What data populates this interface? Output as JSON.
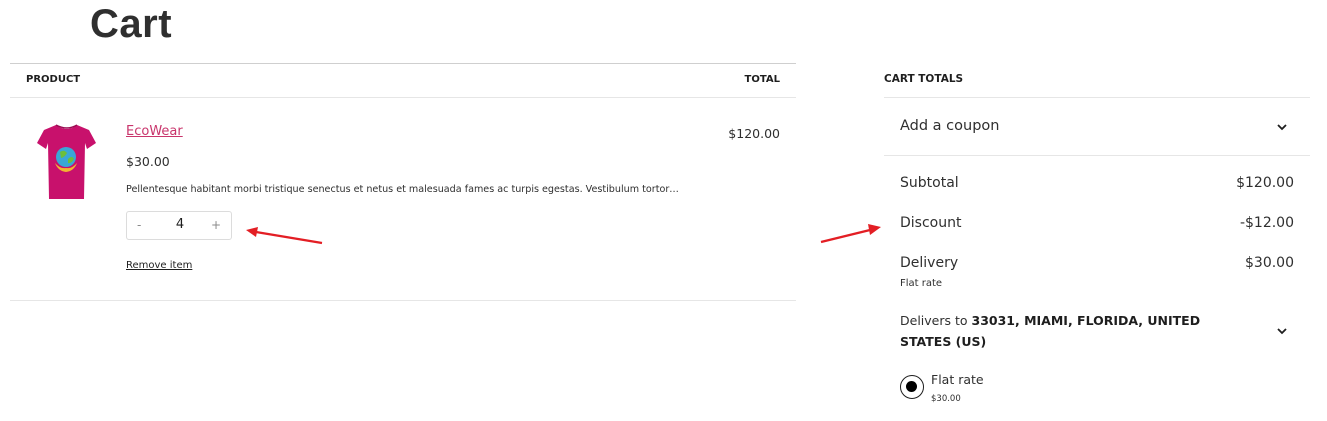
{
  "page": {
    "title": "Cart"
  },
  "table": {
    "product_header": "PRODUCT",
    "total_header": "TOTAL"
  },
  "item": {
    "name": "EcoWear",
    "price": "$30.00",
    "description": "Pellentesque habitant morbi tristique senectus et netus et malesuada fames ac turpis egestas. Vestibulum tortor…",
    "quantity": "4",
    "minus": "-",
    "plus": "+",
    "remove_label": "Remove item",
    "line_total": "$120.00",
    "image_icon": "tshirt-icon",
    "shirt_color": "#c8116c"
  },
  "totals": {
    "heading": "CART TOTALS",
    "coupon_label": "Add a coupon",
    "subtotal_label": "Subtotal",
    "subtotal_value": "$120.00",
    "discount_label": "Discount",
    "discount_value": "-$12.00",
    "delivery_label": "Delivery",
    "delivery_value": "$30.00",
    "delivery_method": "Flat rate",
    "delivers_prefix": "Delivers to ",
    "delivers_address": "33031, MIAMI, FLORIDA, UNITED STATES (US)",
    "shipping_option_name": "Flat rate",
    "shipping_option_price": "$30.00",
    "shipping_option_selected": true
  },
  "colors": {
    "link": "#c9356c",
    "arrow": "#e31e24",
    "border": "#e6e6e6"
  }
}
